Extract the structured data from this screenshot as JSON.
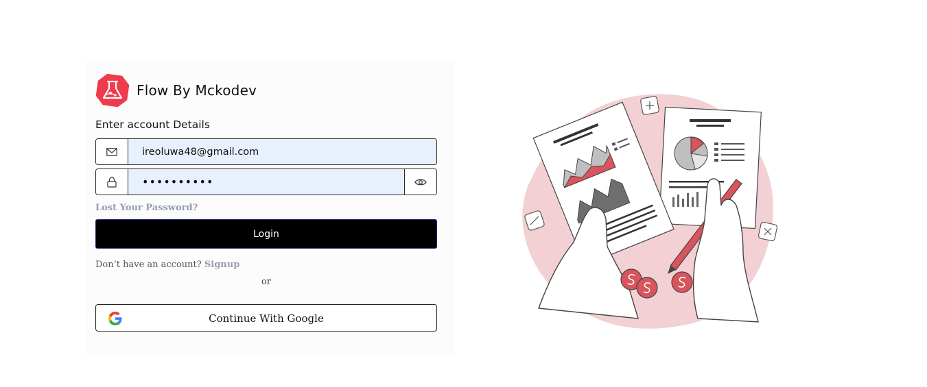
{
  "brand": {
    "name": "Flow By Mckodev",
    "accent": "#ef3b4c"
  },
  "form": {
    "subtitle": "Enter account Details",
    "email_value": "ireoluwa48@gmail.com",
    "password_value": "••••••••••",
    "lost_password": "Lost Your Password?",
    "login_label": "Login",
    "no_account_text": "Don’t have an account?",
    "signup_link": "Signup",
    "or_text": "or",
    "google_label": "Continue With Google"
  },
  "icons": {
    "email": "mail-icon",
    "password": "lock-icon",
    "toggle": "eye-icon",
    "google": "google-icon"
  },
  "colors": {
    "input_fill": "#e8f0fe",
    "button_bg": "#000000",
    "link_muted": "#9a9ab0",
    "illustration_blob": "#f2d0d3",
    "illustration_red": "#d9545c"
  }
}
